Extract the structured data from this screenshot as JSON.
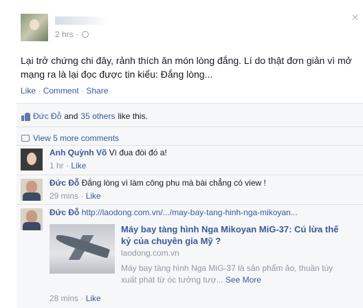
{
  "post": {
    "author_name": "",
    "time": "2 hrs",
    "text": "Lại trở chứng chi đây, rảnh thích ăn món lòng đắng. Lí do thật đơn giản vì mở mạng ra là lại đọc được tin kiểu: Đắng lòng...",
    "actions": {
      "like": "Like",
      "comment": "Comment",
      "share": "Share",
      "sep": " · "
    },
    "close_glyph": "✕"
  },
  "likes": {
    "name": "Đức Đỗ",
    "and": " and ",
    "others": "35 others",
    "suffix": " like this."
  },
  "view_more": "View 5 more comments",
  "comments": [
    {
      "name": "Anh Quỳnh Võ",
      "text": " Vì đua đòi đó a!",
      "time": "1 hr",
      "like": "Like"
    },
    {
      "name": "Đức Đỗ",
      "text": " Đắng lòng vì làm công phu mà bài chẳng có view !",
      "time": "29 mins",
      "like": "Like"
    },
    {
      "name": "Đức Đỗ",
      "text": " http://laodong.com.vn/.../may-bay-tang-hinh-nga-mikoyan...",
      "time": "28 mins",
      "like": "Like"
    }
  ],
  "share_card": {
    "title": "Máy bay tàng hình Nga Mikoyan MiG-37: Cú lừa thế kỷ của chuyên gia Mỹ ?",
    "domain": "laodong.com.vn",
    "description": "Máy bay tàng hình Nga MiG-37 là sản phẩm ảo, thuần túy xuất phát từ óc tưởng tượ...",
    "see_more": "See More"
  },
  "colors": {
    "link": "#3b5998",
    "meta": "#9197a3",
    "ufi_bg": "#f6f7f8"
  }
}
